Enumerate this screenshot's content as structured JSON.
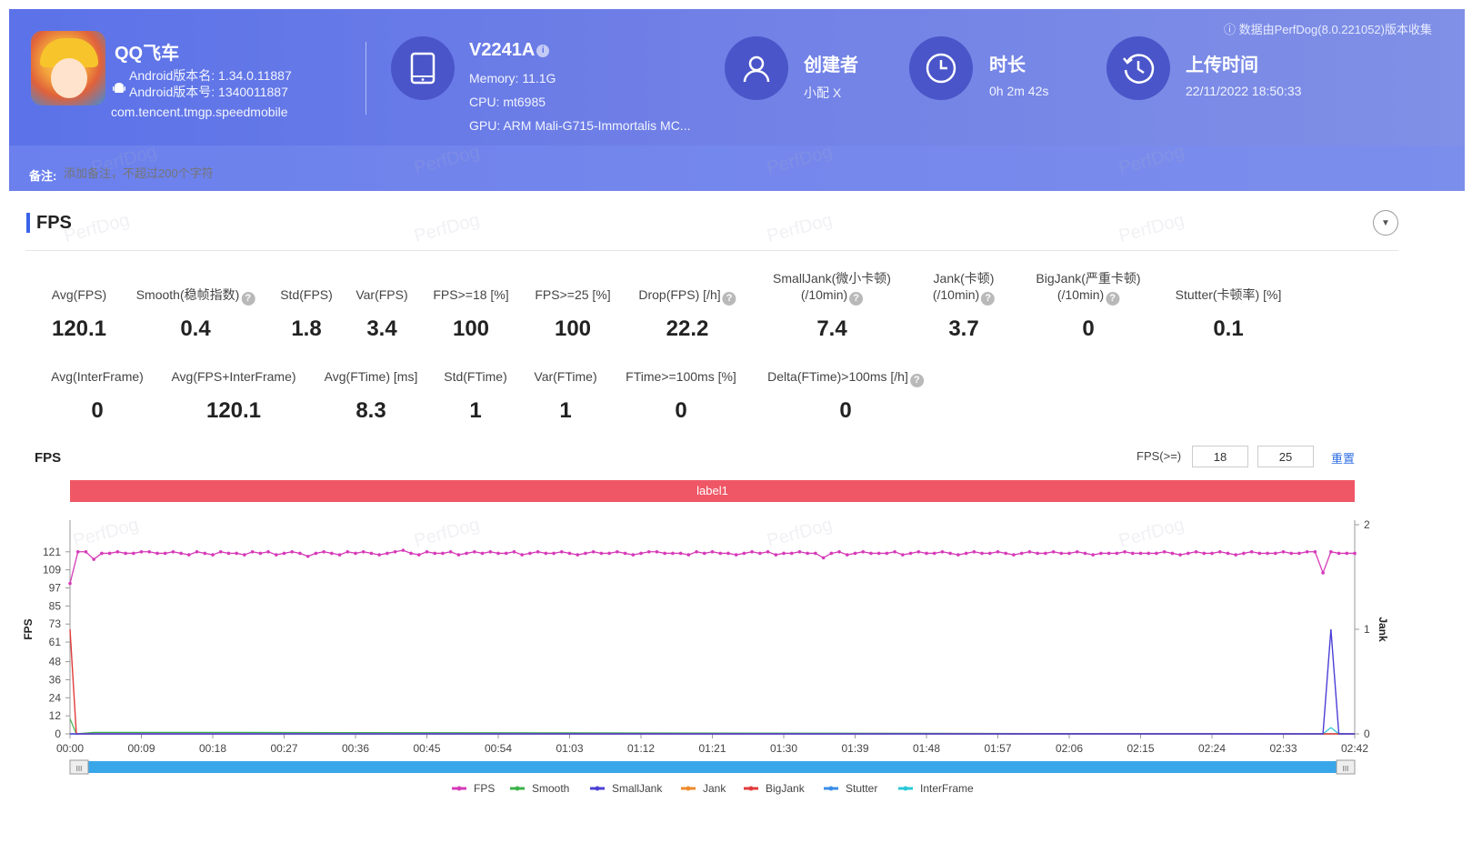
{
  "app": {
    "name": "QQ飞车",
    "version_name": "Android版本名: 1.34.0.11887",
    "version_code": "Android版本号: 1340011887",
    "package": "com.tencent.tmgp.speedmobile"
  },
  "device": {
    "model": "V2241A",
    "memory": "Memory: 11.1G",
    "cpu": "CPU: mt6985",
    "gpu": "GPU: ARM Mali-G715-Immortalis MC..."
  },
  "creator": {
    "title": "创建者",
    "value": "小配 X"
  },
  "duration": {
    "title": "时长",
    "value": "0h 2m 42s"
  },
  "upload": {
    "title": "上传时间",
    "value": "22/11/2022 18:50:33"
  },
  "data_source": "数据由PerfDog(8.0.221052)版本收集",
  "remark": {
    "label": "备注:",
    "placeholder": "添加备注，不超过200个字符"
  },
  "section": {
    "title": "FPS"
  },
  "stats_row1": [
    {
      "label": "Avg(FPS)",
      "value": "120.1",
      "help": false
    },
    {
      "label": "Smooth(稳帧指数)",
      "value": "0.4",
      "help": true
    },
    {
      "label": "Std(FPS)",
      "value": "1.8",
      "help": false
    },
    {
      "label": "Var(FPS)",
      "value": "3.4",
      "help": false
    },
    {
      "label": "FPS>=18 [%]",
      "value": "100",
      "help": false
    },
    {
      "label": "FPS>=25 [%]",
      "value": "100",
      "help": false
    },
    {
      "label": "Drop(FPS) [/h]",
      "value": "22.2",
      "help": true
    },
    {
      "label": "SmallJank(微小卡顿)",
      "label2": "(/10min)",
      "value": "7.4",
      "help": true
    },
    {
      "label": "Jank(卡顿)",
      "label2": "(/10min)",
      "value": "3.7",
      "help": true
    },
    {
      "label": "BigJank(严重卡顿)",
      "label2": "(/10min)",
      "value": "0",
      "help": true
    },
    {
      "label": "Stutter(卡顿率) [%]",
      "value": "0.1",
      "help": false
    }
  ],
  "stats_row2": [
    {
      "label": "Avg(InterFrame)",
      "value": "0",
      "help": false
    },
    {
      "label": "Avg(FPS+InterFrame)",
      "value": "120.1",
      "help": false
    },
    {
      "label": "Avg(FTime) [ms]",
      "value": "8.3",
      "help": false
    },
    {
      "label": "Std(FTime)",
      "value": "1",
      "help": false
    },
    {
      "label": "Var(FTime)",
      "value": "1",
      "help": false
    },
    {
      "label": "FTime>=100ms [%]",
      "value": "0",
      "help": false
    },
    {
      "label": "Delta(FTime)>100ms [/h]",
      "value": "0",
      "help": true
    }
  ],
  "chart_header": {
    "title": "FPS",
    "threshold_label": "FPS(>=)",
    "threshold_1": "18",
    "threshold_2": "25",
    "reset": "重置",
    "label_bar": "label1",
    "watermark": "PerfDog"
  },
  "colors": {
    "FPS": "#d63ab8",
    "Smooth": "#3cb24a",
    "SmallJank": "#4b3fd6",
    "Jank": "#f08a2a",
    "BigJank": "#e23a3a",
    "Stutter": "#3a8de8",
    "InterFrame": "#29c8d8"
  },
  "chart_data": {
    "type": "line",
    "ylabel": "FPS",
    "y2label": "Jank",
    "y_ticks": [
      0,
      12,
      24,
      36,
      48,
      61,
      73,
      85,
      97,
      109,
      121
    ],
    "ylim": [
      0,
      139
    ],
    "y2_ticks": [
      0,
      1,
      2
    ],
    "y2lim": [
      0,
      2
    ],
    "x_ticks": [
      "00:00",
      "00:09",
      "00:18",
      "00:27",
      "00:36",
      "00:45",
      "00:54",
      "01:03",
      "01:12",
      "01:21",
      "01:30",
      "01:39",
      "01:48",
      "01:57",
      "02:06",
      "02:15",
      "02:24",
      "02:33",
      "02:42"
    ],
    "xlim_seconds": [
      0,
      162
    ],
    "legend": [
      "FPS",
      "Smooth",
      "SmallJank",
      "Jank",
      "BigJank",
      "Stutter",
      "InterFrame"
    ],
    "fps": {
      "x_seconds": [
        0,
        1,
        2,
        3,
        4,
        5,
        6,
        7,
        8,
        9,
        10,
        11,
        12,
        13,
        14,
        15,
        16,
        17,
        18,
        19,
        20,
        21,
        22,
        23,
        24,
        25,
        26,
        27,
        28,
        29,
        30,
        31,
        32,
        33,
        34,
        35,
        36,
        37,
        38,
        39,
        40,
        41,
        42,
        43,
        44,
        45,
        46,
        47,
        48,
        49,
        50,
        51,
        52,
        53,
        54,
        55,
        56,
        57,
        58,
        59,
        60,
        61,
        62,
        63,
        64,
        65,
        66,
        67,
        68,
        69,
        70,
        71,
        72,
        73,
        74,
        75,
        76,
        77,
        78,
        79,
        80,
        81,
        82,
        83,
        84,
        85,
        86,
        87,
        88,
        89,
        90,
        91,
        92,
        93,
        94,
        95,
        96,
        97,
        98,
        99,
        100,
        101,
        102,
        103,
        104,
        105,
        106,
        107,
        108,
        109,
        110,
        111,
        112,
        113,
        114,
        115,
        116,
        117,
        118,
        119,
        120,
        121,
        122,
        123,
        124,
        125,
        126,
        127,
        128,
        129,
        130,
        131,
        132,
        133,
        134,
        135,
        136,
        137,
        138,
        139,
        140,
        141,
        142,
        143,
        144,
        145,
        146,
        147,
        148,
        149,
        150,
        151,
        152,
        153,
        154,
        155,
        156,
        157,
        158,
        159,
        160,
        161,
        162
      ],
      "values": [
        100,
        121,
        121,
        116,
        120,
        120,
        121,
        120,
        120,
        121,
        121,
        120,
        120,
        121,
        120,
        119,
        121,
        120,
        119,
        121,
        120,
        120,
        119,
        121,
        120,
        121,
        119,
        120,
        121,
        120,
        118,
        120,
        121,
        120,
        119,
        121,
        120,
        121,
        120,
        119,
        120,
        121,
        122,
        120,
        119,
        121,
        120,
        120,
        121,
        119,
        120,
        121,
        120,
        121,
        120,
        120,
        121,
        119,
        120,
        121,
        120,
        120,
        121,
        120,
        119,
        120,
        121,
        120,
        120,
        121,
        120,
        119,
        120,
        121,
        121,
        120,
        120,
        120,
        119,
        121,
        120,
        121,
        120,
        120,
        119,
        120,
        121,
        120,
        121,
        119,
        120,
        120,
        121,
        120,
        120,
        117,
        120,
        121,
        119,
        120,
        121,
        120,
        120,
        120,
        121,
        119,
        120,
        121,
        120,
        120,
        121,
        120,
        119,
        120,
        121,
        120,
        120,
        121,
        120,
        119,
        120,
        121,
        120,
        120,
        121,
        120,
        120,
        121,
        120,
        119,
        120,
        120,
        120,
        121,
        120,
        120,
        120,
        120,
        121,
        120,
        119,
        120,
        121,
        120,
        120,
        121,
        120,
        119,
        120,
        121,
        120,
        120,
        120,
        121,
        120,
        120,
        121,
        121,
        107,
        121,
        120,
        120,
        120
      ]
    },
    "smooth": {
      "x_seconds": [
        0,
        0.8,
        3,
        18,
        162
      ],
      "values": [
        10,
        0,
        1,
        1,
        0
      ]
    },
    "small_jank": {
      "x_seconds": [
        0,
        158,
        159,
        160,
        162
      ],
      "values": [
        0,
        0,
        1,
        0,
        0
      ]
    },
    "big_jank": {
      "x_seconds": [
        0,
        0.8,
        162
      ],
      "values": [
        1,
        0,
        0
      ]
    },
    "stutter": {
      "x_seconds": [
        0,
        162
      ],
      "values": [
        0,
        0
      ]
    },
    "inter_frame": {
      "x_seconds": [
        0,
        158,
        159,
        160,
        162
      ],
      "values": [
        0,
        0,
        0.06,
        0,
        0
      ]
    }
  }
}
